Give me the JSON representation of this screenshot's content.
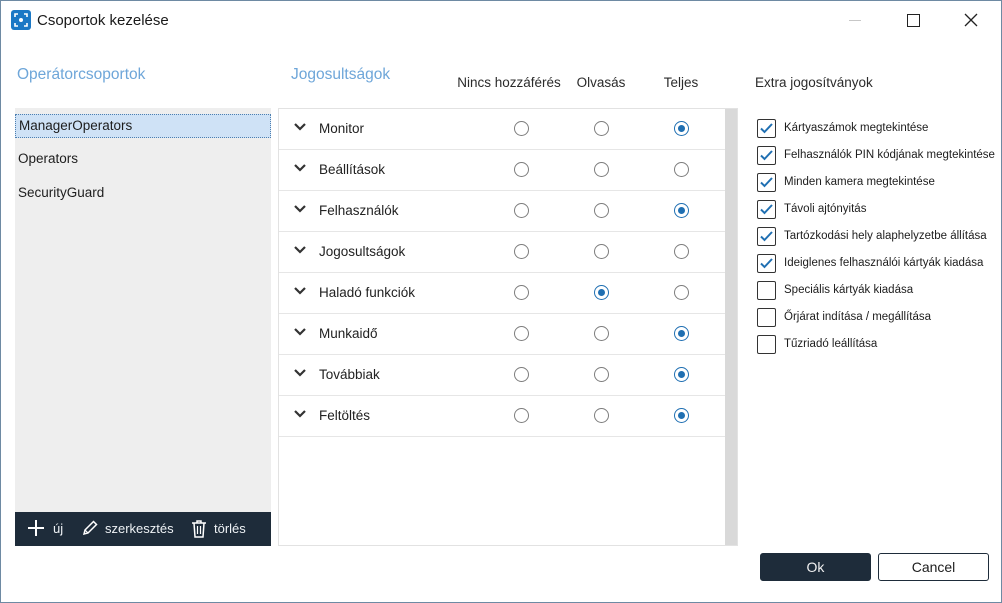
{
  "window": {
    "title": "Csoportok kezelése"
  },
  "groups": {
    "title": "Operátorcsoportok",
    "items": [
      {
        "label": "ManagerOperators",
        "selected": true
      },
      {
        "label": "Operators",
        "selected": false
      },
      {
        "label": "SecurityGuard",
        "selected": false
      }
    ],
    "toolbar": {
      "new_label": "új",
      "edit_label": "szerkesztés",
      "delete_label": "törlés"
    }
  },
  "permissions": {
    "title": "Jogosultságok",
    "columns": [
      "Nincs hozzáférés",
      "Olvasás",
      "Teljes"
    ],
    "rows": [
      {
        "label": "Monitor",
        "value": "Teljes"
      },
      {
        "label": "Beállítások",
        "value": null
      },
      {
        "label": "Felhasználók",
        "value": "Teljes"
      },
      {
        "label": "Jogosultságok",
        "value": null
      },
      {
        "label": "Haladó funkciók",
        "value": "Olvasás"
      },
      {
        "label": "Munkaidő",
        "value": "Teljes"
      },
      {
        "label": "Továbbiak",
        "value": "Teljes"
      },
      {
        "label": "Feltöltés",
        "value": "Teljes"
      }
    ]
  },
  "extra": {
    "title": "Extra jogosítványok",
    "items": [
      {
        "label": "Kártyaszámok megtekintése",
        "checked": true
      },
      {
        "label": "Felhasználók PIN kódjának megtekintése",
        "checked": true
      },
      {
        "label": "Minden kamera megtekintése",
        "checked": true
      },
      {
        "label": "Távoli ajtónyitás",
        "checked": true
      },
      {
        "label": "Tartózkodási hely alaphelyzetbe állítása",
        "checked": true
      },
      {
        "label": "Ideiglenes felhasználói kártyák kiadása",
        "checked": true
      },
      {
        "label": "Speciális kártyák kiadása",
        "checked": false
      },
      {
        "label": "Őrjárat indítása / megállítása",
        "checked": false
      },
      {
        "label": "Tűzriadó leállítása",
        "checked": false
      }
    ]
  },
  "buttons": {
    "ok_label": "Ok",
    "cancel_label": "Cancel"
  },
  "colors": {
    "accent": "#1f6fb2",
    "section_title": "#6ea6d9",
    "dark_bar": "#1e2c3a",
    "selection": "#cfe2f6"
  }
}
